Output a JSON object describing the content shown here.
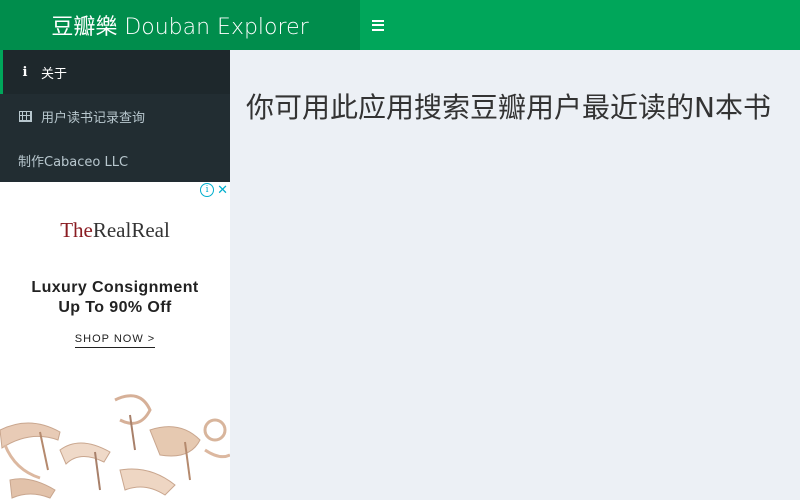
{
  "header": {
    "logo": "豆瓣樂 Douban Explorer",
    "toggle_icon": "hamburger-icon"
  },
  "sidebar": {
    "items": [
      {
        "label": "关于",
        "icon": "info-icon",
        "active": true
      },
      {
        "label": "用户读书记录查询",
        "icon": "table-icon",
        "active": false
      },
      {
        "label": "制作Cabaceo LLC",
        "icon": "",
        "active": false
      }
    ]
  },
  "ad": {
    "brand_the": "The",
    "brand_name": "RealReal",
    "headline_1": "Luxury Consignment",
    "headline_2": "Up To 90% Off",
    "cta": "SHOP NOW >",
    "choices_icon": "i",
    "close_icon": "✕"
  },
  "main": {
    "title": "你可用此应用搜索豆瓣用户最近读的N本书"
  },
  "colors": {
    "header_dark": "#008d4c",
    "header": "#00a65a",
    "sidebar": "#222d32",
    "sidebar_active": "#1e282c",
    "content_bg": "#ecf0f5"
  }
}
